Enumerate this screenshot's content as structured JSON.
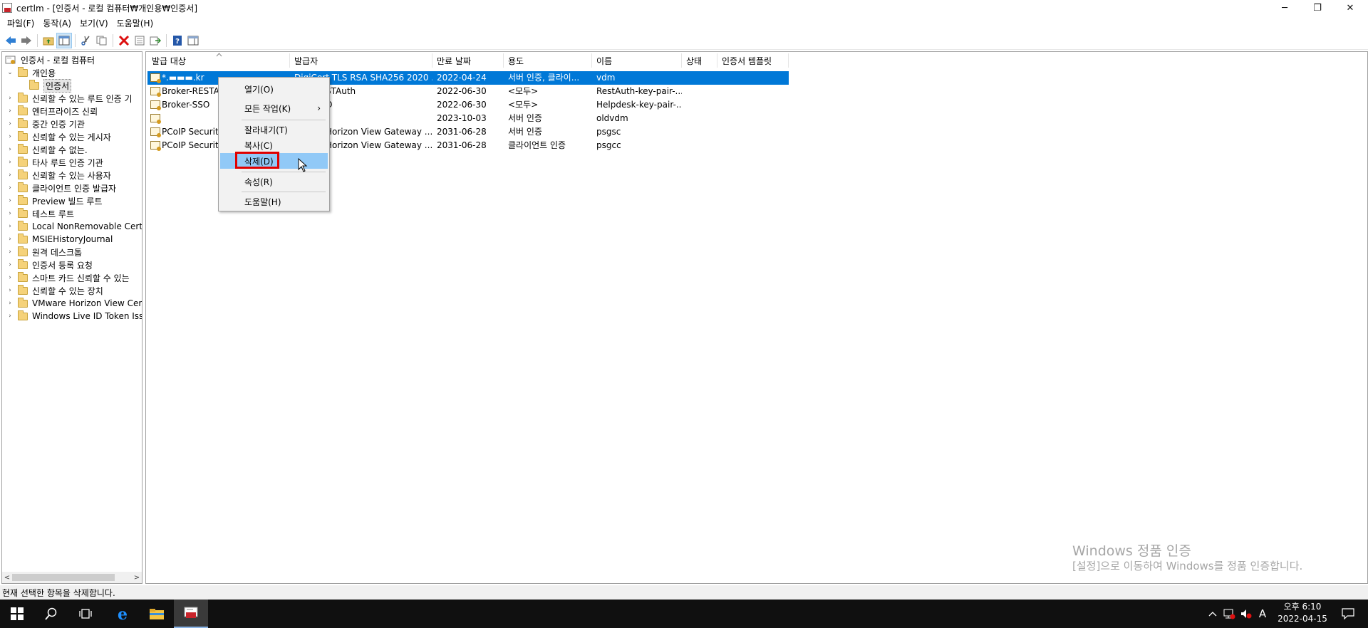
{
  "window": {
    "title": "certlm - [인증서 - 로컬 컴퓨터₩개인용₩인증서]",
    "minimize": "─",
    "maximize": "❐",
    "close": "✕"
  },
  "menu": [
    "파일(F)",
    "동작(A)",
    "보기(V)",
    "도움말(H)"
  ],
  "tree": {
    "items": [
      {
        "label": "인증서 - 로컬 컴퓨터",
        "level": 0,
        "expander": ""
      },
      {
        "label": "개인용",
        "level": 1,
        "expander": "⌄"
      },
      {
        "label": "인증서",
        "level": 2,
        "expander": ""
      },
      {
        "label": "신뢰할 수 있는 루트 인증 기",
        "level": 1,
        "expander": "›"
      },
      {
        "label": "엔터프라이즈 신뢰",
        "level": 1,
        "expander": "›"
      },
      {
        "label": "중간 인증 기관",
        "level": 1,
        "expander": "›"
      },
      {
        "label": "신뢰할 수 있는 게시자",
        "level": 1,
        "expander": "›"
      },
      {
        "label": "신뢰할 수 없는.",
        "level": 1,
        "expander": "›"
      },
      {
        "label": "타사 루트 인증 기관",
        "level": 1,
        "expander": "›"
      },
      {
        "label": "신뢰할 수 있는 사용자",
        "level": 1,
        "expander": "›"
      },
      {
        "label": "클라이언트 인증 발급자",
        "level": 1,
        "expander": "›"
      },
      {
        "label": "Preview 빌드 루트",
        "level": 1,
        "expander": "›"
      },
      {
        "label": "테스트 루트",
        "level": 1,
        "expander": "›"
      },
      {
        "label": "Local NonRemovable Certific",
        "level": 1,
        "expander": "›"
      },
      {
        "label": "MSIEHistoryJournal",
        "level": 1,
        "expander": "›"
      },
      {
        "label": "원격 데스크톱",
        "level": 1,
        "expander": "›"
      },
      {
        "label": "인증서 등록 요청",
        "level": 1,
        "expander": "›"
      },
      {
        "label": "스마트 카드 신뢰할 수 있는",
        "level": 1,
        "expander": "›"
      },
      {
        "label": "신뢰할 수 있는 장치",
        "level": 1,
        "expander": "›"
      },
      {
        "label": "VMware Horizon View Certif",
        "level": 1,
        "expander": "›"
      },
      {
        "label": "Windows Live ID Token Issue",
        "level": 1,
        "expander": "›"
      }
    ]
  },
  "list": {
    "columns": [
      "발급 대상",
      "발급자",
      "만료 날짜",
      "용도",
      "이름",
      "상태",
      "인증서 템플릿"
    ],
    "rows": [
      [
        "*.▬▬▬.kr",
        "DigiCert TLS RSA SHA256 2020 ...",
        "2022-04-24",
        "서버 인증, 클라이...",
        "vdm",
        "",
        ""
      ],
      [
        "Broker-RESTAu",
        "STAuth",
        "2022-06-30",
        "<모두>",
        "RestAuth-key-pair-...",
        "",
        ""
      ],
      [
        "Broker-SSO",
        "O",
        "2022-06-30",
        "<모두>",
        "Helpdesk-key-pair-...",
        "",
        ""
      ],
      [
        "",
        "",
        "2023-10-03",
        "서버 인증",
        "oldvdm",
        "",
        ""
      ],
      [
        "PCoIP Security",
        "Horizon View Gateway ...",
        "2031-06-28",
        "서버 인증",
        "psgsc",
        "",
        ""
      ],
      [
        "PCoIP Security",
        "Horizon View Gateway ...",
        "2031-06-28",
        "클라이언트 인증",
        "psgcc",
        "",
        ""
      ]
    ]
  },
  "context_menu": {
    "open": "열기(O)",
    "all_tasks": "모든 작업(K)",
    "submenu_arrow": "›",
    "cut": "잘라내기(T)",
    "copy": "복사(C)",
    "delete": "삭제(D)",
    "properties": "속성(R)",
    "help": "도움말(H)"
  },
  "watermark": {
    "line1": "Windows 정품 인증",
    "line2": "[설정]으로 이동하여 Windows를 정품 인증합니다."
  },
  "status": "현재 선택한 항목을 삭제합니다.",
  "taskbar": {
    "ime": "A",
    "time": "오후 6:10",
    "date": "2022-04-15"
  }
}
